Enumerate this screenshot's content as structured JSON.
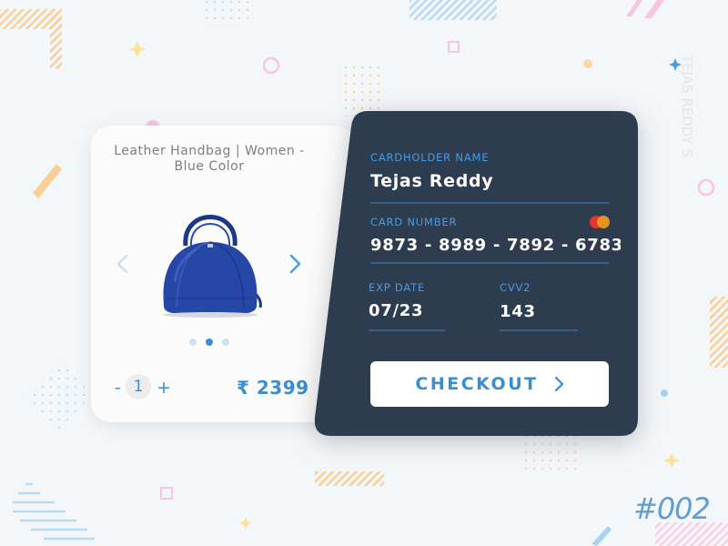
{
  "product": {
    "title": "Leather Handbag | Women - Blue Color",
    "price": "₹ 2399",
    "quantity": "1",
    "qty_minus": "-",
    "qty_plus": "+",
    "carousel_total": 3,
    "carousel_active": 2
  },
  "payment": {
    "cardholder_label": "CARDHOLDER NAME",
    "cardholder_value": "Tejas Reddy",
    "card_number_label": "CARD NUMBER",
    "card_number_value": "9873 - 8989 - 7892 - 6783",
    "card_brand_icon": "mastercard-icon",
    "exp_label": "EXP DATE",
    "exp_value": "07/23",
    "cvv_label": "CVV2",
    "cvv_value": "143",
    "checkout_label": "CHECKOUT"
  },
  "watermark": "TEJAS REDDY S",
  "shot_number": "#002",
  "colors": {
    "background": "#f4f7f9",
    "panel": "#2d3c4f",
    "accent": "#3b8dd0",
    "label": "#4a9be0",
    "bag": "#2747a8"
  }
}
